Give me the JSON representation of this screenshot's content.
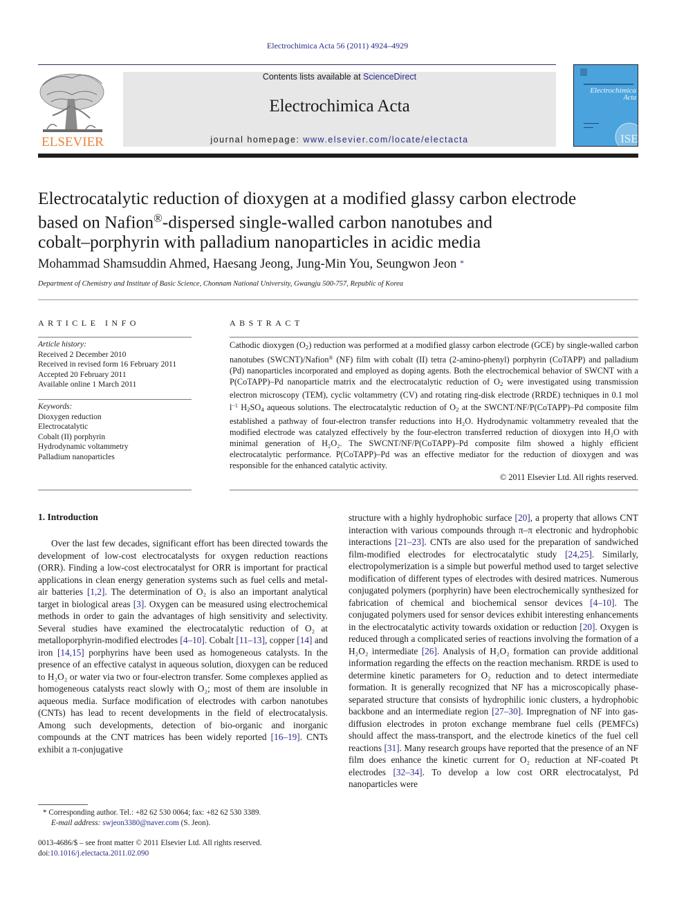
{
  "header": {
    "citation": "Electrochimica Acta 56 (2011) 4924–4929",
    "contents_prefix": "Contents lists available at ",
    "contents_link": "ScienceDirect",
    "journal_title": "Electrochimica Acta",
    "homepage_prefix": "journal homepage: ",
    "homepage_url": "www.elsevier.com/locate/electacta",
    "publisher_logo": "ELSEVIER",
    "cover_title_line1": "Electrochimica",
    "cover_title_line2": "Acta",
    "cover_badge": "ISE",
    "colors": {
      "link": "#2a2a8a",
      "elsevier_orange": "#e8833a",
      "cover_blue": "#4aa3dd",
      "banner_gray": "#e7e7e7"
    }
  },
  "article": {
    "title_line1": "Electrocatalytic reduction of dioxygen at a modified glassy carbon electrode",
    "title_line2_a": "based on Nafion",
    "title_line2_sup": "®",
    "title_line2_b": "-dispersed single-walled carbon nanotubes and",
    "title_line3": "cobalt–porphyrin with palladium nanoparticles in acidic media",
    "authors": "Mohammad Shamsuddin Ahmed, Haesang Jeong, Jung-Min You, Seungwon Jeon",
    "author_mark": "*",
    "affiliation": "Department of Chemistry and Institute of Basic Science, Chonnam National University, Gwangju 500-757, Republic of Korea"
  },
  "article_info": {
    "heading": "ARTICLE INFO",
    "history_label": "Article history:",
    "history": [
      "Received 2 December 2010",
      "Received in revised form 16 February 2011",
      "Accepted 20 February 2011",
      "Available online 1 March 2011"
    ],
    "keywords_label": "Keywords:",
    "keywords": [
      "Dioxygen reduction",
      "Electrocatalytic",
      "Cobalt (II) porphyrin",
      "Hydrodynamic voltammetry",
      "Palladium nanoparticles"
    ]
  },
  "abstract": {
    "heading": "ABSTRACT",
    "p1": "Cathodic dioxygen (O",
    "p2": ") reduction was performed at a modified glassy carbon electrode (GCE) by single-walled carbon nanotubes (SWCNT)/Nafion",
    "p3": " (NF) film with cobalt (II) tetra (2-amino-phenyl) porphyrin (CoTAPP) and palladium (Pd) nanoparticles incorporated and employed as doping agents. Both the electrochemical behavior of SWCNT with a P(CoTAPP)–Pd nanoparticle matrix and the electrocatalytic reduction of O",
    "p4": " were investigated using transmission electron microscopy (TEM), cyclic voltammetry (CV) and rotating ring-disk electrode (RRDE) techniques in 0.1 mol l",
    "p5": " H",
    "p6": "SO",
    "p7": " aqueous solutions. The electrocatalytic reduction of O",
    "p8": " at the SWCNT/NF/P(CoTAPP)–Pd composite film established a pathway of four-electron transfer reductions into H₂O. Hydrodynamic voltammetry revealed that the modified electrode was catalyzed effectively by the four-electron transferred reduction of dioxygen into H₂O with minimal generation of H₂O₂. The SWCNT/NF/P(CoTAPP)–Pd composite film showed a highly efficient electrocatalytic performance. P(CoTAPP)–Pd was an effective mediator for the reduction of dioxygen and was responsible for the enhanced catalytic activity.",
    "copyright": "© 2011 Elsevier Ltd. All rights reserved."
  },
  "intro": {
    "heading": "1.  Introduction",
    "col1": [
      {
        "t": "Over the last few decades, significant effort has been directed towards the development of low-cost electrocatalysts for oxygen reduction reactions (ORR). Finding a low-cost electrocatalyst for ORR is important for practical applications in clean energy generation systems such as fuel cells and metal-air batteries "
      },
      {
        "c": "[1,2]"
      },
      {
        "t": ". The determination of O₂ is also an important analytical target in biological areas "
      },
      {
        "c": "[3]"
      },
      {
        "t": ". Oxygen can be measured using electrochemical methods in order to gain the advantages of high sensitivity and selectivity. Several studies have examined the electrocatalytic reduction of O₂ at metalloporphyrin-modified electrodes "
      },
      {
        "c": "[4–10]"
      },
      {
        "t": ". Cobalt "
      },
      {
        "c": "[11–13]"
      },
      {
        "t": ", copper "
      },
      {
        "c": "[14]"
      },
      {
        "t": " and iron "
      },
      {
        "c": "[14,15]"
      },
      {
        "t": " porphyrins have been used as homogeneous catalysts. In the presence of an effective catalyst in aqueous solution, dioxygen can be reduced to H₂O₂ or water via two or four-electron transfer. Some complexes applied as homogeneous catalysts react slowly with O₂; most of them are insoluble in aqueous media. Surface modification of electrodes with carbon nanotubes (CNTs) has lead to recent developments in the field of electrocatalysis. Among such developments, detection of bio-organic and inorganic compounds at the CNT matrices has been widely reported "
      },
      {
        "c": "[16–19]"
      },
      {
        "t": ". CNTs exhibit a π-conjugative"
      }
    ],
    "col2": [
      {
        "t": "structure with a highly hydrophobic surface "
      },
      {
        "c": "[20]"
      },
      {
        "t": ", a property that allows CNT interaction with various compounds through π–π electronic and hydrophobic interactions "
      },
      {
        "c": "[21–23]"
      },
      {
        "t": ". CNTs are also used for the preparation of sandwiched film-modified electrodes for electrocatalytic study "
      },
      {
        "c": "[24,25]"
      },
      {
        "t": ". Similarly, electropolymerization is a simple but powerful method used to target selective modification of different types of electrodes with desired matrices. Numerous conjugated polymers (porphyrin) have been electrochemically synthesized for fabrication of chemical and biochemical sensor devices "
      },
      {
        "c": "[4–10]"
      },
      {
        "t": ". The conjugated polymers used for sensor devices exhibit interesting enhancements in the electrocatalytic activity towards oxidation or reduction "
      },
      {
        "c": "[20]"
      },
      {
        "t": ". Oxygen is reduced through a complicated series of reactions involving the formation of a H₂O₂ intermediate "
      },
      {
        "c": "[26]"
      },
      {
        "t": ". Analysis of H₂O₂ formation can provide additional information regarding the effects on the reaction mechanism. RRDE is used to determine kinetic parameters for O₂ reduction and to detect intermediate formation. It is generally recognized that NF has a microscopically phase-separated structure that consists of hydrophilic ionic clusters, a hydrophobic backbone and an intermediate region "
      },
      {
        "c": "[27–30]"
      },
      {
        "t": ". Impregnation of NF into gas-diffusion electrodes in proton exchange membrane fuel cells (PEMFCs) should affect the mass-transport, and the electrode kinetics of the fuel cell reactions "
      },
      {
        "c": "[31]"
      },
      {
        "t": ". Many research groups have reported that the presence of an NF film does enhance the kinetic current for O₂ reduction at NF-coated Pt electrodes "
      },
      {
        "c": "[32–34]"
      },
      {
        "t": ". To develop a low cost ORR electrocatalyst, Pd nanoparticles were"
      }
    ]
  },
  "footnote": {
    "mark": "*",
    "corresponding": "Corresponding author. Tel.: +82 62 530 0064; fax: +82 62 530 3389.",
    "email_label": "E-mail address: ",
    "email": "swjeon3380@naver.com",
    "email_suffix": " (S. Jeon).",
    "front_matter": "0013-4686/$ – see front matter © 2011 Elsevier Ltd. All rights reserved.",
    "doi_label": "doi:",
    "doi": "10.1016/j.electacta.2011.02.090"
  }
}
